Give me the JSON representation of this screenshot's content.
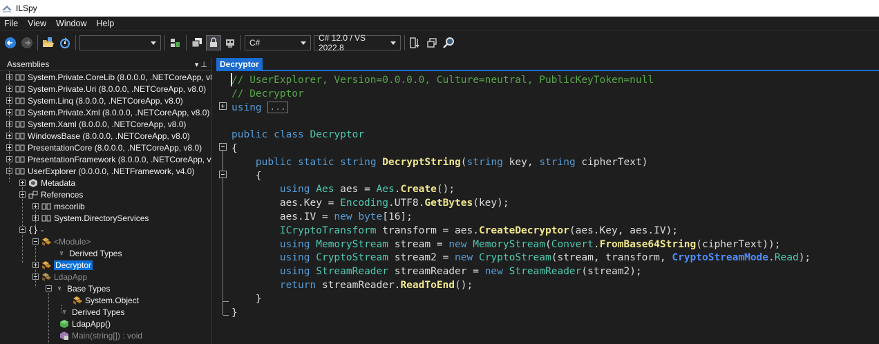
{
  "window": {
    "title": "ILSpy"
  },
  "menu": [
    "File",
    "View",
    "Window",
    "Help"
  ],
  "toolbar": {
    "assembly_list_value": "",
    "language_value": "C#",
    "version_value": "C# 12.0 / VS 2022.8"
  },
  "assemblies_panel": {
    "title": "Assemblies",
    "pin_glyph": "▾  ⊥"
  },
  "tree": [
    {
      "label": "System.Private.CoreLib (8.0.0.0, .NETCoreApp, v8"
    },
    {
      "label": "System.Private.Uri (8.0.0.0, .NETCoreApp, v8.0)"
    },
    {
      "label": "System.Linq (8.0.0.0, .NETCoreApp, v8.0)"
    },
    {
      "label": "System.Private.Xml (8.0.0.0, .NETCoreApp, v8.0)"
    },
    {
      "label": "System.Xaml (8.0.0.0, .NETCoreApp, v8.0)"
    },
    {
      "label": "WindowsBase (8.0.0.0, .NETCoreApp, v8.0)"
    },
    {
      "label": "PresentationCore (8.0.0.0, .NETCoreApp, v8.0)"
    },
    {
      "label": "PresentationFramework (8.0.0.0, .NETCoreApp, v"
    },
    {
      "label": "UserExplorer (0.0.0.0, .NETFramework, v4.0)"
    },
    {
      "label": "Metadata"
    },
    {
      "label": "References"
    },
    {
      "label": "mscorlib"
    },
    {
      "label": "System.DirectoryServices"
    },
    {
      "label": "-"
    },
    {
      "label": "<Module>"
    },
    {
      "label": "Derived Types"
    },
    {
      "label": "Decryptor"
    },
    {
      "label": "LdapApp"
    },
    {
      "label": "Base Types"
    },
    {
      "label": "System.Object"
    },
    {
      "label": "Derived Types"
    },
    {
      "label": "LdapApp()"
    },
    {
      "label": "Main(string[]) : void"
    }
  ],
  "editor": {
    "tab_label": "Decryptor",
    "lines": [
      [
        {
          "t": "// UserExplorer, Version=0.0.0.0, Culture=neutral, PublicKeyToken=null",
          "c": "c-com"
        }
      ],
      [
        {
          "t": "// Decryptor",
          "c": "c-com"
        }
      ],
      [
        {
          "t": "using",
          "c": "c-kw"
        },
        {
          "t": " ",
          "c": ""
        },
        {
          "t": "...",
          "c": "ellipsis-box"
        }
      ],
      [
        {
          "t": "",
          "c": ""
        }
      ],
      [
        {
          "t": "public",
          "c": "c-kw"
        },
        {
          "t": " ",
          "c": ""
        },
        {
          "t": "class",
          "c": "c-kw"
        },
        {
          "t": " ",
          "c": ""
        },
        {
          "t": "Decryptor",
          "c": "c-type"
        }
      ],
      [
        {
          "t": "{",
          "c": ""
        }
      ],
      [
        {
          "t": "    ",
          "c": ""
        },
        {
          "t": "public",
          "c": "c-kw"
        },
        {
          "t": " ",
          "c": ""
        },
        {
          "t": "static",
          "c": "c-kw"
        },
        {
          "t": " ",
          "c": ""
        },
        {
          "t": "string",
          "c": "c-kw"
        },
        {
          "t": " ",
          "c": ""
        },
        {
          "t": "DecryptString",
          "c": "c-meth"
        },
        {
          "t": "(",
          "c": ""
        },
        {
          "t": "string",
          "c": "c-kw"
        },
        {
          "t": " key, ",
          "c": ""
        },
        {
          "t": "string",
          "c": "c-kw"
        },
        {
          "t": " cipherText)",
          "c": ""
        }
      ],
      [
        {
          "t": "    {",
          "c": ""
        }
      ],
      [
        {
          "t": "        ",
          "c": ""
        },
        {
          "t": "using",
          "c": "c-kw"
        },
        {
          "t": " ",
          "c": ""
        },
        {
          "t": "Aes",
          "c": "c-type"
        },
        {
          "t": " aes = ",
          "c": ""
        },
        {
          "t": "Aes",
          "c": "c-type"
        },
        {
          "t": ".",
          "c": ""
        },
        {
          "t": "Create",
          "c": "c-meth"
        },
        {
          "t": "();",
          "c": ""
        }
      ],
      [
        {
          "t": "        aes.Key = ",
          "c": ""
        },
        {
          "t": "Encoding",
          "c": "c-type"
        },
        {
          "t": ".UTF8.",
          "c": ""
        },
        {
          "t": "GetBytes",
          "c": "c-meth"
        },
        {
          "t": "(key);",
          "c": ""
        }
      ],
      [
        {
          "t": "        aes.IV = ",
          "c": ""
        },
        {
          "t": "new",
          "c": "c-kw"
        },
        {
          "t": " ",
          "c": ""
        },
        {
          "t": "byte",
          "c": "c-kw"
        },
        {
          "t": "[16];",
          "c": ""
        }
      ],
      [
        {
          "t": "        ",
          "c": ""
        },
        {
          "t": "ICryptoTransform",
          "c": "c-type"
        },
        {
          "t": " transform = aes.",
          "c": ""
        },
        {
          "t": "CreateDecryptor",
          "c": "c-meth"
        },
        {
          "t": "(aes.Key, aes.IV);",
          "c": ""
        }
      ],
      [
        {
          "t": "        ",
          "c": ""
        },
        {
          "t": "using",
          "c": "c-kw"
        },
        {
          "t": " ",
          "c": ""
        },
        {
          "t": "MemoryStream",
          "c": "c-type"
        },
        {
          "t": " stream = ",
          "c": ""
        },
        {
          "t": "new",
          "c": "c-kw"
        },
        {
          "t": " ",
          "c": ""
        },
        {
          "t": "MemoryStream",
          "c": "c-type"
        },
        {
          "t": "(",
          "c": ""
        },
        {
          "t": "Convert",
          "c": "c-type"
        },
        {
          "t": ".",
          "c": ""
        },
        {
          "t": "FromBase64String",
          "c": "c-meth"
        },
        {
          "t": "(cipherText));",
          "c": ""
        }
      ],
      [
        {
          "t": "        ",
          "c": ""
        },
        {
          "t": "using",
          "c": "c-kw"
        },
        {
          "t": " ",
          "c": ""
        },
        {
          "t": "CryptoStream",
          "c": "c-type"
        },
        {
          "t": " stream2 = ",
          "c": ""
        },
        {
          "t": "new",
          "c": "c-kw"
        },
        {
          "t": " ",
          "c": ""
        },
        {
          "t": "CryptoStream",
          "c": "c-type"
        },
        {
          "t": "(stream, transform, ",
          "c": ""
        },
        {
          "t": "CryptoStreamMode",
          "c": "c-blue"
        },
        {
          "t": ".",
          "c": ""
        },
        {
          "t": "Read",
          "c": "c-field"
        },
        {
          "t": ");",
          "c": ""
        }
      ],
      [
        {
          "t": "        ",
          "c": ""
        },
        {
          "t": "using",
          "c": "c-kw"
        },
        {
          "t": " ",
          "c": ""
        },
        {
          "t": "StreamReader",
          "c": "c-type"
        },
        {
          "t": " streamReader = ",
          "c": ""
        },
        {
          "t": "new",
          "c": "c-kw"
        },
        {
          "t": " ",
          "c": ""
        },
        {
          "t": "StreamReader",
          "c": "c-type"
        },
        {
          "t": "(stream2);",
          "c": ""
        }
      ],
      [
        {
          "t": "        ",
          "c": ""
        },
        {
          "t": "return",
          "c": "c-kw"
        },
        {
          "t": " streamReader.",
          "c": ""
        },
        {
          "t": "ReadToEnd",
          "c": "c-meth"
        },
        {
          "t": "();",
          "c": ""
        }
      ],
      [
        {
          "t": "    }",
          "c": ""
        }
      ],
      [
        {
          "t": "}",
          "c": ""
        }
      ]
    ]
  }
}
